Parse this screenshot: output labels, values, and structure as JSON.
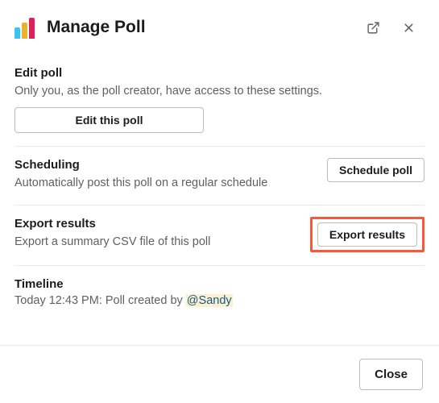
{
  "header": {
    "title": "Manage Poll"
  },
  "sections": {
    "edit": {
      "title": "Edit poll",
      "desc": "Only you, as the poll creator, have access to these settings.",
      "button": "Edit this poll"
    },
    "scheduling": {
      "title": "Scheduling",
      "desc": "Automatically post this poll on a regular schedule",
      "button": "Schedule poll"
    },
    "export": {
      "title": "Export results",
      "desc": "Export a summary CSV file of this poll",
      "button": "Export results"
    },
    "timeline": {
      "title": "Timeline",
      "entry_prefix": "Today 12:43 PM: Poll created by ",
      "entry_mention": "@Sandy"
    }
  },
  "footer": {
    "close": "Close"
  }
}
